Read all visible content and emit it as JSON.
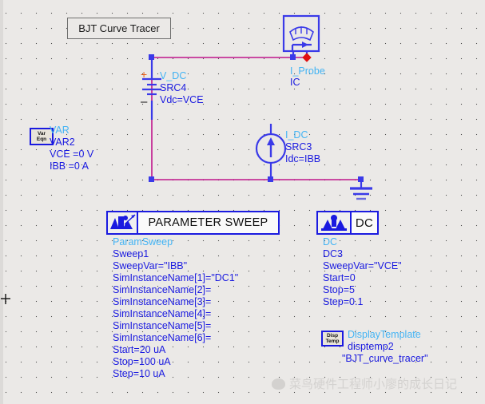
{
  "window": {
    "title_box": "BJT Curve Tracer",
    "background_color": "#ebe9e7",
    "wire_color": "#c0158c",
    "component_color": "#1a1ae0",
    "type_label_color": "#44b4f4"
  },
  "components": {
    "v_dc": {
      "type": "V_DC",
      "instance": "SRC4",
      "param": "Vdc=VCE",
      "plus_sign": "+",
      "minus_sign": "–",
      "icon": "battery-icon"
    },
    "i_probe": {
      "type": "I_Probe",
      "instance": "IC",
      "icon": "ammeter-icon"
    },
    "i_dc": {
      "type": "I_DC",
      "instance": "SRC3",
      "param": "Idc=IBB",
      "icon": "current-source-icon"
    },
    "ground": {
      "icon": "ground-icon"
    },
    "var": {
      "icon_line1": "Var",
      "icon_line2": "Eqn",
      "type": "VAR",
      "instance": "VAR2",
      "params": [
        "VCE =0 V",
        "IBB =0 A"
      ]
    },
    "display_template": {
      "icon_line1": "Disp",
      "icon_line2": "Temp",
      "type": "DisplayTemplate",
      "instance": "disptemp2",
      "param": "\"BJT_curve_tracer\""
    }
  },
  "param_sweep": {
    "box_label": "PARAMETER SWEEP",
    "icon": "param-sweep-icon",
    "type": "ParamSweep",
    "instance": "Sweep1",
    "params": [
      "SweepVar=\"IBB\"",
      "SimInstanceName[1]=\"DC1\"",
      "SimInstanceName[2]=",
      "SimInstanceName[3]=",
      "SimInstanceName[4]=",
      "SimInstanceName[5]=",
      "SimInstanceName[6]=",
      "Start=20 uA",
      "Stop=100 uA",
      "Step=10 uA"
    ]
  },
  "dc_sim": {
    "box_label": "DC",
    "icon": "dc-sim-icon",
    "type": "DC",
    "instance": "DC3",
    "params": [
      "SweepVar=\"VCE\"",
      "Start=0",
      "Stop=5",
      "Step=0.1"
    ]
  },
  "watermark": {
    "icon": "wechat-icon",
    "text": "菜鸟硬件工程师小廖的成长日记"
  }
}
